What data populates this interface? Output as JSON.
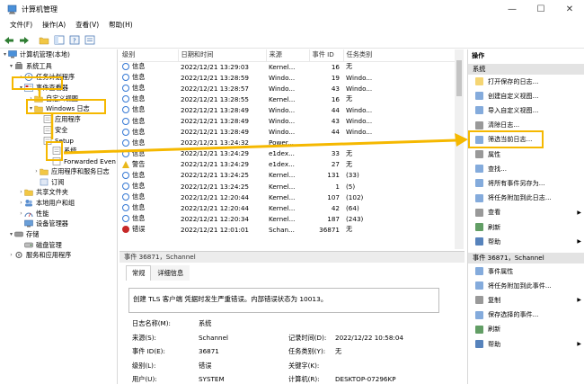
{
  "window": {
    "title": "计算机管理",
    "minimize": "—",
    "maximize": "☐",
    "close": "✕"
  },
  "menu": [
    "文件(F)",
    "操作(A)",
    "查看(V)",
    "帮助(H)"
  ],
  "tree": {
    "root": "计算机管理(本地)",
    "system_tools": "系统工具",
    "task_scheduler": "任务计划程序",
    "event_viewer": "事件查看器",
    "custom_views": "自定义视图",
    "windows_logs": "Windows 日志",
    "application": "应用程序",
    "security": "安全",
    "setup": "Setup",
    "system": "系统",
    "forwarded": "Forwarded Even",
    "app_service_logs": "应用程序和服务日志",
    "subscriptions": "订阅",
    "shared_folders": "共享文件夹",
    "local_users": "本地用户和组",
    "performance": "性能",
    "device_manager": "设备管理器",
    "storage": "存储",
    "disk_management": "磁盘管理",
    "services_apps": "服务和应用程序"
  },
  "list": {
    "columns": [
      "级别",
      "日期和时间",
      "来源",
      "事件 ID",
      "任务类别"
    ],
    "rows": [
      {
        "level": "信息",
        "icon": "info",
        "dt": "2022/12/21 13:29:03",
        "src": "Kernel...",
        "id": "16",
        "cat": "无"
      },
      {
        "level": "信息",
        "icon": "info",
        "dt": "2022/12/21 13:28:59",
        "src": "Windo...",
        "id": "19",
        "cat": "Windo..."
      },
      {
        "level": "信息",
        "icon": "info",
        "dt": "2022/12/21 13:28:57",
        "src": "Windo...",
        "id": "43",
        "cat": "Windo..."
      },
      {
        "level": "信息",
        "icon": "info",
        "dt": "2022/12/21 13:28:55",
        "src": "Kernel...",
        "id": "16",
        "cat": "无"
      },
      {
        "level": "信息",
        "icon": "info",
        "dt": "2022/12/21 13:28:49",
        "src": "Windo...",
        "id": "44",
        "cat": "Windo..."
      },
      {
        "level": "信息",
        "icon": "info",
        "dt": "2022/12/21 13:28:49",
        "src": "Windo...",
        "id": "43",
        "cat": "Windo..."
      },
      {
        "level": "信息",
        "icon": "info",
        "dt": "2022/12/21 13:28:49",
        "src": "Windo...",
        "id": "44",
        "cat": "Windo..."
      },
      {
        "level": "信息",
        "icon": "info",
        "dt": "2022/12/21 13:24:32",
        "src": "Power...",
        "id": "",
        "cat": ""
      },
      {
        "level": "信息",
        "icon": "info",
        "dt": "2022/12/21 13:24:29",
        "src": "e1dex...",
        "id": "33",
        "cat": "无"
      },
      {
        "level": "警告",
        "icon": "warn",
        "dt": "2022/12/21 13:24:29",
        "src": "e1dex...",
        "id": "27",
        "cat": "无"
      },
      {
        "level": "信息",
        "icon": "info",
        "dt": "2022/12/21 13:24:25",
        "src": "Kernel...",
        "id": "131",
        "cat": "(33)"
      },
      {
        "level": "信息",
        "icon": "info",
        "dt": "2022/12/21 13:24:25",
        "src": "Kernel...",
        "id": "1",
        "cat": "(5)"
      },
      {
        "level": "信息",
        "icon": "info",
        "dt": "2022/12/21 12:20:44",
        "src": "Kernel...",
        "id": "107",
        "cat": "(102)"
      },
      {
        "level": "信息",
        "icon": "info",
        "dt": "2022/12/21 12:20:44",
        "src": "Kernel...",
        "id": "42",
        "cat": "(64)"
      },
      {
        "level": "信息",
        "icon": "info",
        "dt": "2022/12/21 12:20:34",
        "src": "Kernel...",
        "id": "187",
        "cat": "(243)"
      },
      {
        "level": "错误",
        "icon": "err",
        "dt": "2022/12/21 12:01:01",
        "src": "Schan...",
        "id": "36871",
        "cat": "无"
      }
    ]
  },
  "detail": {
    "header": "事件 36871，Schannel",
    "tab_general": "常规",
    "tab_details": "详细信息",
    "message": "创建 TLS 客户端 凭据时发生严重错误。内部错误状态为 10013。",
    "log_name_label": "日志名称(M):",
    "log_name": "系统",
    "source_label": "来源(S):",
    "source": "Schannel",
    "logged_label": "记录时间(D):",
    "logged": "2022/12/22 10:58:04",
    "event_id_label": "事件 ID(E):",
    "event_id": "36871",
    "task_label": "任务类别(Y):",
    "task": "无",
    "level_label": "级别(L):",
    "level": "错误",
    "keywords_label": "关键字(K):",
    "keywords": "",
    "user_label": "用户(U):",
    "user": "SYSTEM",
    "computer_label": "计算机(R):",
    "computer": "DESKTOP-07296KP"
  },
  "actions": {
    "title": "操作",
    "section1": "系统",
    "items1": [
      "打开保存的日志...",
      "创建自定义视图...",
      "导入自定义视图...",
      "清除日志...",
      "筛选当前日志...",
      "属性",
      "查找...",
      "将所有事件另存为...",
      "将任务附加到此日志...",
      "查看",
      "刷新",
      "帮助"
    ],
    "section2": "事件 36871，Schannel",
    "items2": [
      "事件属性",
      "将任务附加到此事件...",
      "复制",
      "保存选择的事件...",
      "刷新",
      "帮助"
    ]
  },
  "colors": {
    "highlight": "#f5b800",
    "info": "#3478d4",
    "warning": "#e9b81a",
    "error": "#c62828"
  }
}
